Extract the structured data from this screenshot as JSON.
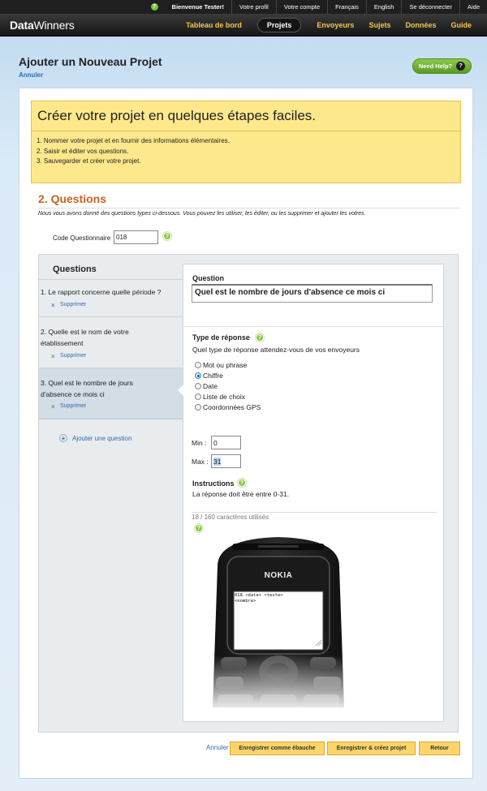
{
  "topbar": {
    "welcome": "Bienvenue Tester!",
    "links": [
      "Votre profil",
      "Votre compte",
      "Français",
      "English",
      "Se déconnecter",
      "Aide"
    ]
  },
  "navbar": {
    "logo_bold": "Data",
    "logo_rest": "Winners",
    "items": [
      "Tableau de bord",
      "Projets",
      "Envoyeurs",
      "Sujets",
      "Données",
      "Guide"
    ],
    "active_item": "Projets"
  },
  "header": {
    "title": "Ajouter un Nouveau Projet",
    "cancel": "Annuler",
    "need_help": "Need Help?"
  },
  "banner": {
    "title": "Créer votre projet en quelques étapes faciles.",
    "steps": [
      "1. Nommer votre projet et en fournir des informations élémentaires.",
      "2. Saisir et éditer vos questions.",
      "3. Sauvegarder et créer votre projet."
    ]
  },
  "section": {
    "title": "2. Questions",
    "description": "Nous vous avons donné des questions types ci-dessous. Vous pouvez les utiliser, les éditer, ou les supprimer et ajouter les votres.",
    "code_label": "Code Questionnaire",
    "code_value": "018"
  },
  "question_list": {
    "title": "Questions",
    "items": [
      {
        "line1": "1.  Le rapport concerne quelle période ?",
        "line2": "",
        "delete": "Supprimer"
      },
      {
        "line1": "2.  Quelle est le nom de votre",
        "line2": "établissement",
        "delete": "Supprimer"
      },
      {
        "line1": "3.  Quel est le nombre de jours",
        "line2": "d'absence ce mois ci",
        "delete": "Supprimer"
      }
    ],
    "add_question": "Ajouter une question"
  },
  "editor": {
    "question_label": "Question",
    "question_value": "Quel est le nombre de jours d'absence ce mois ci",
    "response_type_label": "Type de réponse",
    "response_type_hint": "Quel type de réponse attendez-vous de vos envoyeurs",
    "options": [
      "Mot ou phrase",
      "Chiffre",
      "Date",
      "Liste de choix",
      "Coordonnées GPS"
    ],
    "selected_option": "Chiffre",
    "min_label": "Min :",
    "min_value": "0",
    "max_label": "Max :",
    "max_value": "31",
    "instructions_label": "Instructions",
    "instructions_text": "La réponse doit être entre 0-31.",
    "char_count": "18 / 160 caractères utilisés"
  },
  "phone": {
    "brand": "NOKIA",
    "sms_preview": "018 <date> <texte>\n<nombre>"
  },
  "footer": {
    "cancel": "Annuler",
    "save_draft": "Enregistrer comme ébauche",
    "save_create": "Enregistrer & créez projet",
    "back": "Retour"
  }
}
